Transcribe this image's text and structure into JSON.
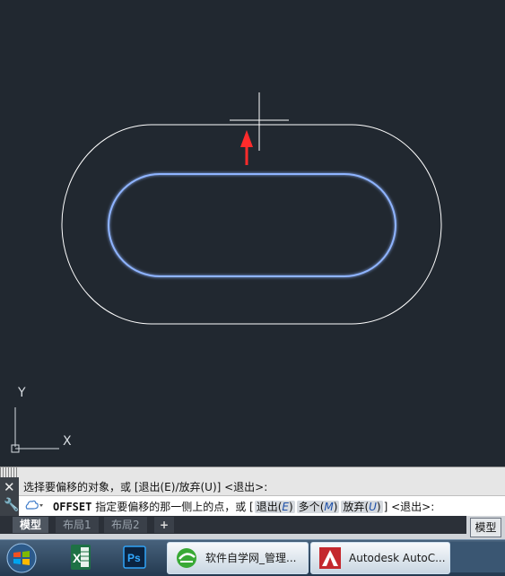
{
  "viewport": {
    "ucs_x_label": "X",
    "ucs_y_label": "Y",
    "colors": {
      "background": "#212830",
      "original_outline": "#ffffff",
      "selected_outline": "#8fb4ff",
      "arrow": "#ff2b2b",
      "crosshair": "#ffffff"
    }
  },
  "command": {
    "history_line": "选择要偏移的对象，或 [退出(E)/放弃(U)] <退出>:",
    "command_name": "OFFSET",
    "prompt_text": "指定要偏移的那一侧上的点，或 [",
    "options": [
      {
        "label": "退出",
        "key": "E"
      },
      {
        "label": "多个",
        "key": "M"
      },
      {
        "label": "放弃",
        "key": "U"
      }
    ],
    "prompt_tail": "] <退出>:",
    "close_icon": "close-icon",
    "wrench_icon": "wrench-icon"
  },
  "layout_tabs": {
    "tabs": [
      "模型",
      "布局1",
      "布局2"
    ],
    "add_label": "+",
    "active": "模型",
    "status_label": "模型"
  },
  "taskbar": {
    "pinned": [
      "excel-icon",
      "photoshop-icon"
    ],
    "ps_label": "Ps",
    "excel_label": "X",
    "apps": [
      {
        "label": "软件自学网_管理...",
        "icon": "browser-icon"
      },
      {
        "label": "Autodesk AutoC...",
        "icon": "autocad-icon"
      }
    ]
  }
}
